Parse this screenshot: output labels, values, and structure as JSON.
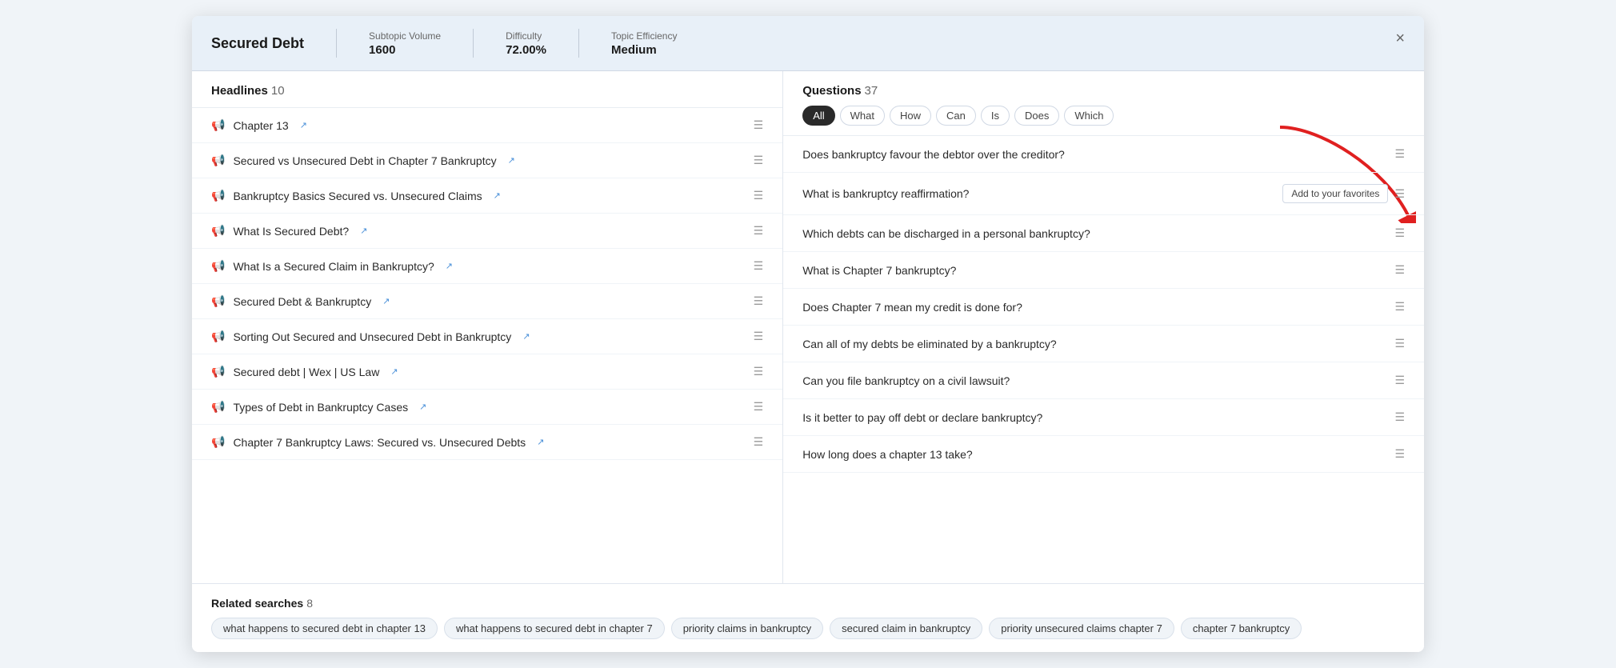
{
  "header": {
    "title": "Secured Debt",
    "stats": [
      {
        "label": "Subtopic Volume",
        "value": "1600"
      },
      {
        "label": "Difficulty",
        "value": "72.00%"
      },
      {
        "label": "Topic Efficiency",
        "value": "Medium"
      }
    ],
    "close_label": "×"
  },
  "headlines": {
    "label": "Headlines",
    "count": "10",
    "items": [
      {
        "text": "Chapter 13"
      },
      {
        "text": "Secured vs Unsecured Debt in Chapter 7 Bankruptcy"
      },
      {
        "text": "Bankruptcy Basics Secured vs. Unsecured Claims"
      },
      {
        "text": "What Is Secured Debt?"
      },
      {
        "text": "What Is a Secured Claim in Bankruptcy?"
      },
      {
        "text": "Secured Debt & Bankruptcy"
      },
      {
        "text": "Sorting Out Secured and Unsecured Debt in Bankruptcy"
      },
      {
        "text": "Secured debt | Wex | US Law"
      },
      {
        "text": "Types of Debt in Bankruptcy Cases"
      },
      {
        "text": "Chapter 7 Bankruptcy Laws: Secured vs. Unsecured Debts"
      }
    ]
  },
  "questions": {
    "label": "Questions",
    "count": "37",
    "filters": [
      {
        "label": "All",
        "active": true
      },
      {
        "label": "What",
        "active": false
      },
      {
        "label": "How",
        "active": false
      },
      {
        "label": "Can",
        "active": false
      },
      {
        "label": "Is",
        "active": false
      },
      {
        "label": "Does",
        "active": false
      },
      {
        "label": "Which",
        "active": false
      }
    ],
    "items": [
      {
        "text": "Does bankruptcy favour the debtor over the creditor?",
        "show_favorite": false
      },
      {
        "text": "What is bankruptcy reaffirmation?",
        "show_favorite": true
      },
      {
        "text": "Which debts can be discharged in a personal bankruptcy?",
        "show_favorite": false
      },
      {
        "text": "What is Chapter 7 bankruptcy?",
        "show_favorite": false
      },
      {
        "text": "Does Chapter 7 mean my credit is done for?",
        "show_favorite": false
      },
      {
        "text": "Can all of my debts be eliminated by a bankruptcy?",
        "show_favorite": false
      },
      {
        "text": "Can you file bankruptcy on a civil lawsuit?",
        "show_favorite": false
      },
      {
        "text": "Is it better to pay off debt or declare bankruptcy?",
        "show_favorite": false
      },
      {
        "text": "How long does a chapter 13 take?",
        "show_favorite": false
      }
    ],
    "favorite_label": "Add to your favorites"
  },
  "related_searches": {
    "label": "Related searches",
    "count": "8",
    "tags": [
      "what happens to secured debt in chapter 13",
      "what happens to secured debt in chapter 7",
      "priority claims in bankruptcy",
      "secured claim in bankruptcy",
      "priority unsecured claims chapter 7",
      "chapter 7 bankruptcy"
    ]
  }
}
